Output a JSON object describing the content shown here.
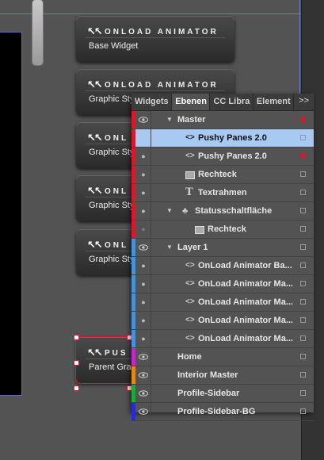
{
  "widgets": [
    {
      "title": "ONLOAD ANIMATOR",
      "sub": "Base Widget"
    },
    {
      "title": "ONLOAD ANIMATOR",
      "sub": "Graphic Style"
    },
    {
      "title": "ONL",
      "sub": "Graphic Sty"
    },
    {
      "title": "ONL",
      "sub": "Graphic Sty"
    },
    {
      "title": "ONL",
      "sub": "Graphic Sty"
    },
    {
      "title": "PUS",
      "sub": "Parent Gra"
    }
  ],
  "logo": "↖↖",
  "panel": {
    "tabs": [
      "Widgets",
      "Ebenen",
      "CC Libra",
      "Element"
    ],
    "more": ">>",
    "rows": [
      {
        "label": "Master",
        "stripe": "#d01c2d",
        "eye": true,
        "disclose": "▼",
        "icon": "",
        "indent": 0,
        "sq": "#d01c2d"
      },
      {
        "label": "Pushy Panes 2.0",
        "stripe": "#d01c2d",
        "eye": false,
        "disclose": "",
        "icon": "<>",
        "indent": 2,
        "sq": "",
        "selected": true
      },
      {
        "label": "Pushy Panes 2.0",
        "stripe": "#d01c2d",
        "eye": "dot",
        "disclose": "",
        "icon": "<>",
        "indent": 2,
        "sq": "#d01c2d"
      },
      {
        "label": "Rechteck",
        "stripe": "#d01c2d",
        "eye": "dot",
        "disclose": "",
        "icon": "rect",
        "indent": 2,
        "sq": ""
      },
      {
        "label": "Textrahmen",
        "stripe": "#d01c2d",
        "eye": "dot",
        "disclose": "",
        "icon": "T",
        "indent": 2,
        "sq": ""
      },
      {
        "label": "Statusschaltfläche",
        "stripe": "#d01c2d",
        "eye": "dot",
        "disclose": "▼",
        "icon": "♣",
        "indent": 1,
        "sq": ""
      },
      {
        "label": "Rechteck",
        "stripe": "#d01c2d",
        "eye": "dot-dim",
        "disclose": "",
        "icon": "rect",
        "indent": 3,
        "sq": ""
      },
      {
        "label": "Layer 1",
        "stripe": "#4a90d9",
        "eye": true,
        "disclose": "▼",
        "icon": "",
        "indent": 0,
        "sq": ""
      },
      {
        "label": "OnLoad Animator Ba...",
        "stripe": "#4a90d9",
        "eye": "dot",
        "disclose": "",
        "icon": "<>",
        "indent": 2,
        "sq": ""
      },
      {
        "label": "OnLoad Animator Ma...",
        "stripe": "#4a90d9",
        "eye": "dot",
        "disclose": "",
        "icon": "<>",
        "indent": 2,
        "sq": ""
      },
      {
        "label": "OnLoad Animator Ma...",
        "stripe": "#4a90d9",
        "eye": "dot",
        "disclose": "",
        "icon": "<>",
        "indent": 2,
        "sq": ""
      },
      {
        "label": "OnLoad Animator Ma...",
        "stripe": "#4a90d9",
        "eye": "dot",
        "disclose": "",
        "icon": "<>",
        "indent": 2,
        "sq": ""
      },
      {
        "label": "OnLoad Animator Ma...",
        "stripe": "#4a90d9",
        "eye": "dot",
        "disclose": "",
        "icon": "<>",
        "indent": 2,
        "sq": ""
      },
      {
        "label": "Home",
        "stripe": "#c02ac8",
        "eye": true,
        "disclose": "",
        "icon": "",
        "indent": 0,
        "sq": ""
      },
      {
        "label": "Interior Master",
        "stripe": "#e08a1a",
        "eye": true,
        "disclose": "",
        "icon": "",
        "indent": 0,
        "sq": ""
      },
      {
        "label": "Profile-Sidebar",
        "stripe": "#1fa83a",
        "eye": true,
        "disclose": "",
        "icon": "",
        "indent": 0,
        "sq": ""
      },
      {
        "label": "Profile-Sidebar-BG",
        "stripe": "#2a2ad0",
        "eye": true,
        "disclose": "",
        "icon": "",
        "indent": 0,
        "sq": ""
      }
    ]
  }
}
